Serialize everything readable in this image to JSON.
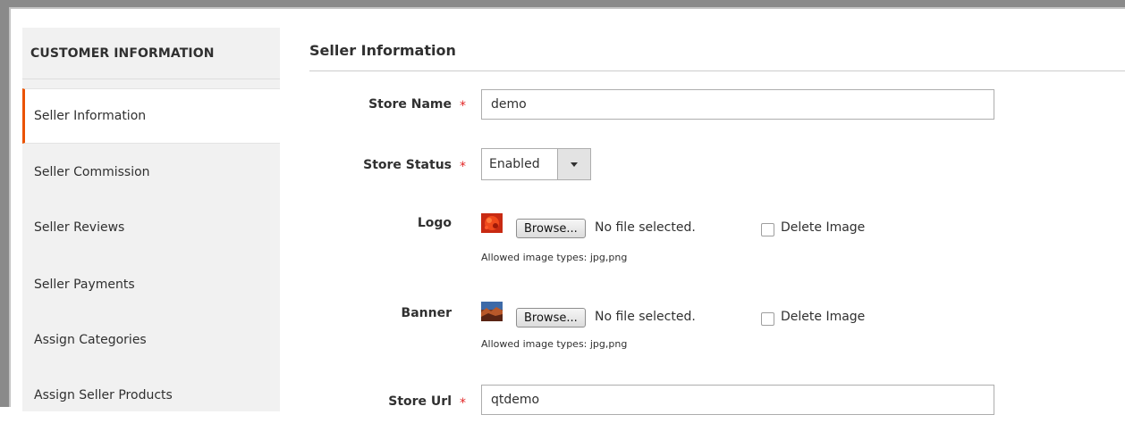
{
  "sidebar": {
    "title": "CUSTOMER INFORMATION",
    "items": [
      {
        "label": "Seller Information",
        "active": true
      },
      {
        "label": "Seller Commission",
        "active": false
      },
      {
        "label": "Seller Reviews",
        "active": false
      },
      {
        "label": "Seller Payments",
        "active": false
      },
      {
        "label": "Assign Categories",
        "active": false
      },
      {
        "label": "Assign Seller Products",
        "active": false
      }
    ]
  },
  "main": {
    "section_title": "Seller Information",
    "required_marker": "*",
    "fields": {
      "store_name": {
        "label": "Store Name",
        "value": "demo"
      },
      "store_status": {
        "label": "Store Status",
        "value": "Enabled",
        "icon": "chevron-down-icon"
      },
      "logo": {
        "label": "Logo",
        "browse_label": "Browse...",
        "file_status": "No file selected.",
        "delete_label": "Delete Image",
        "note": "Allowed image types: jpg,png"
      },
      "banner": {
        "label": "Banner",
        "browse_label": "Browse...",
        "file_status": "No file selected.",
        "delete_label": "Delete Image",
        "note": "Allowed image types: jpg,png"
      },
      "store_url": {
        "label": "Store Url",
        "value": "qtdemo"
      }
    }
  },
  "colors": {
    "accent": "#eb5202",
    "required": "#e22626",
    "sidebar_bg": "#f1f1f1"
  }
}
